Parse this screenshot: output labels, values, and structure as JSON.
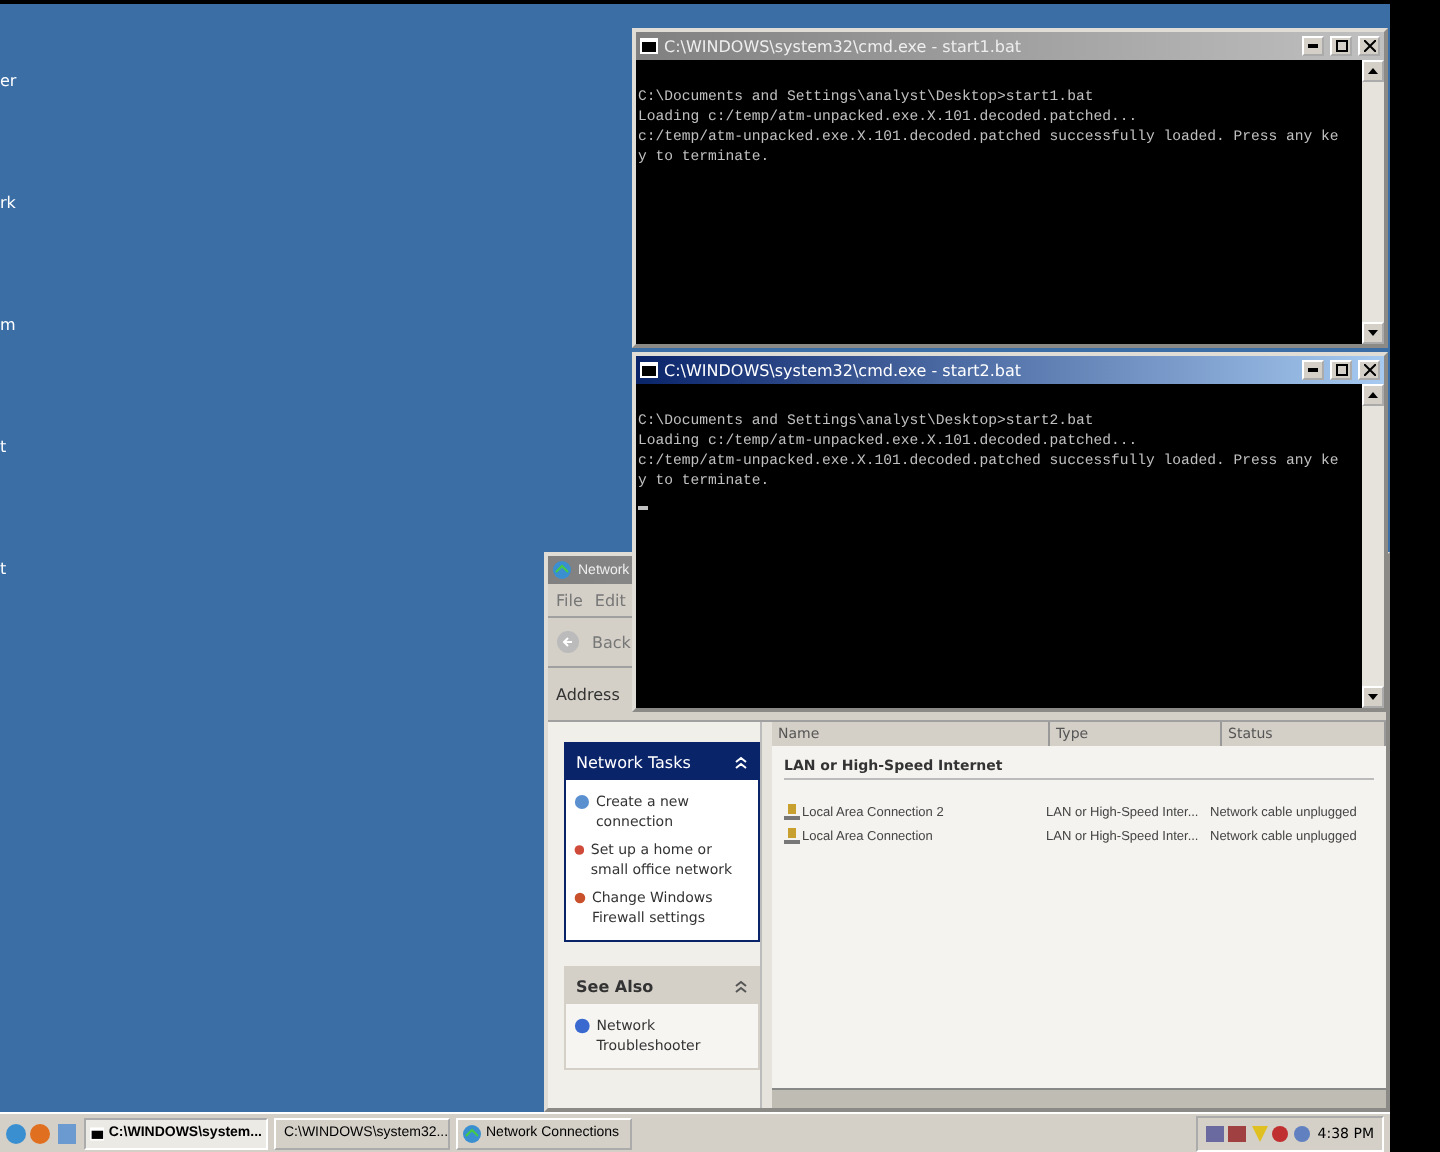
{
  "desktop": {
    "icon_labels": [
      "er",
      "rk",
      "m",
      "t",
      "t"
    ]
  },
  "windows": [
    {
      "kind": "console",
      "title": "C:\\WINDOWS\\system32\\cmd.exe - start1.bat",
      "active": false,
      "cursor": false,
      "lines": [
        "C:\\Documents and Settings\\analyst\\Desktop>start1.bat",
        "Loading c:/temp/atm-unpacked.exe.X.101.decoded.patched...",
        "c:/temp/atm-unpacked.exe.X.101.decoded.patched successfully loaded. Press any ke",
        "y to terminate."
      ]
    },
    {
      "kind": "console",
      "title": "C:\\WINDOWS\\system32\\cmd.exe - start2.bat",
      "active": true,
      "cursor": true,
      "lines": [
        "C:\\Documents and Settings\\analyst\\Desktop>start2.bat",
        "Loading c:/temp/atm-unpacked.exe.X.101.decoded.patched...",
        "c:/temp/atm-unpacked.exe.X.101.decoded.patched successfully loaded. Press any ke",
        "y to terminate."
      ]
    },
    {
      "kind": "explorer",
      "title": "Network",
      "active": false,
      "menu": [
        "File",
        "Edit"
      ],
      "back_label": "Back",
      "address_label": "Address",
      "task_panels": [
        {
          "title": "Network Tasks",
          "kind": "special",
          "expanded": true,
          "items": [
            "Create a new connection",
            "Set up a home or small office network",
            "Change Windows Firewall settings"
          ]
        },
        {
          "title": "See Also",
          "kind": "plain",
          "expanded": true,
          "items": [
            "Network Troubleshooter"
          ]
        }
      ],
      "list": {
        "columns": [
          "Name",
          "Type",
          "Status"
        ],
        "groups": [
          {
            "title": "LAN or High-Speed Internet",
            "rows": [
              {
                "name": "Local Area Connection 2",
                "type": "LAN or High-Speed Inter...",
                "status": "Network cable unplugged"
              },
              {
                "name": "Local Area Connection",
                "type": "LAN or High-Speed Inter...",
                "status": "Network cable unplugged"
              }
            ]
          }
        ]
      }
    }
  ],
  "taskbar": {
    "buttons": [
      {
        "label": "C:\\WINDOWS\\system...",
        "kind": "console",
        "selected": true
      },
      {
        "label": "C:\\WINDOWS\\system32...",
        "kind": "console",
        "selected": false
      },
      {
        "label": "Network Connections",
        "kind": "explorer",
        "selected": false
      }
    ],
    "clock": "4:38 PM"
  }
}
